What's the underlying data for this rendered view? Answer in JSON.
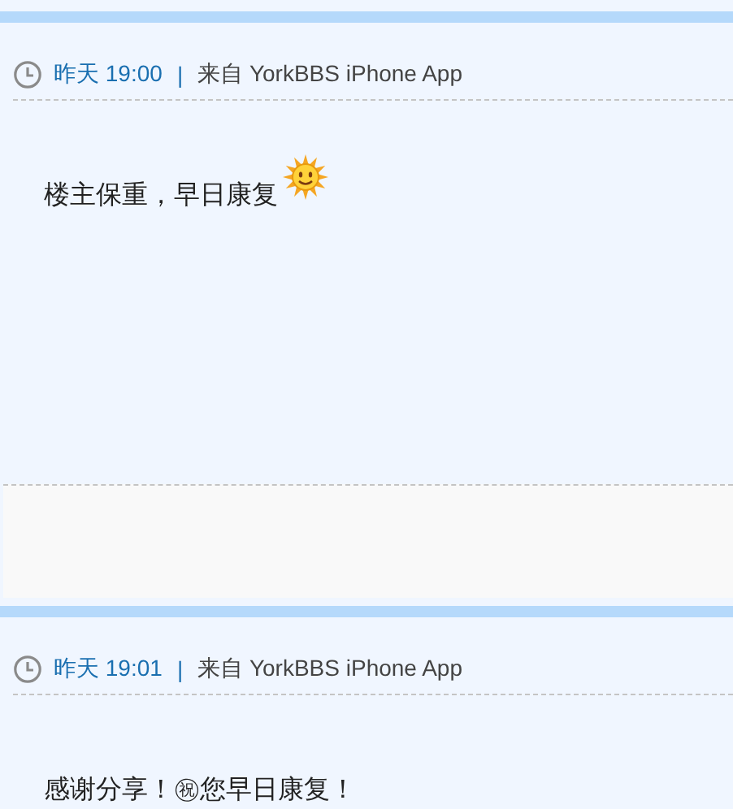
{
  "posts": [
    {
      "time": "昨天 19:00",
      "separator": "|",
      "source": "来自 YorkBBS iPhone App",
      "body": "楼主保重，早日康复",
      "emoji": true,
      "footer": true
    },
    {
      "time": "昨天 19:01",
      "separator": "|",
      "source": "来自 YorkBBS iPhone App",
      "body": "感谢分享！㊗您早日康复！",
      "emoji": false,
      "footer": false
    }
  ]
}
